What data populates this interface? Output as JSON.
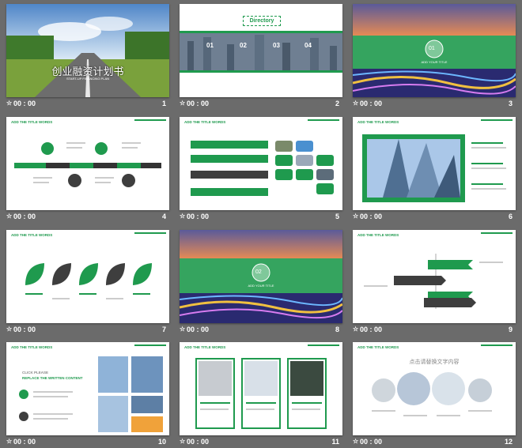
{
  "slides": [
    {
      "num": "1",
      "time": "00 : 00",
      "title": "创业融资计划书",
      "subtitle": "START-UP FINANCING PLAN"
    },
    {
      "num": "2",
      "time": "00 : 00",
      "directory": "Directory",
      "items": [
        "01",
        "02",
        "03",
        "04"
      ]
    },
    {
      "num": "3",
      "time": "00 : 00",
      "badge": "01",
      "caption": "ADD YOUR TITLE"
    },
    {
      "num": "4",
      "time": "00 : 00",
      "header": "ADD THE TITLE WORDS"
    },
    {
      "num": "5",
      "time": "00 : 00",
      "header": "ADD THE TITLE WORDS"
    },
    {
      "num": "6",
      "time": "00 : 00",
      "header": "ADD THE TITLE WORDS"
    },
    {
      "num": "7",
      "time": "00 : 00",
      "header": "ADD THE TITLE WORDS"
    },
    {
      "num": "8",
      "time": "00 : 00",
      "badge": "02",
      "caption": "ADD YOUR TITLE"
    },
    {
      "num": "9",
      "time": "00 : 00",
      "header": "ADD THE TITLE WORDS"
    },
    {
      "num": "10",
      "time": "00 : 00",
      "header": "ADD THE TITLE WORDS",
      "line1": "CLICK PLEASE",
      "line2": "REPLACE THE WRITTEN CONTENT"
    },
    {
      "num": "11",
      "time": "00 : 00",
      "header": "ADD THE TITLE WORDS"
    },
    {
      "num": "12",
      "time": "00 : 00",
      "header": "ADD THE TITLE WORDS",
      "center_title": "点击请替换文字内容"
    }
  ],
  "colors": {
    "accent": "#1f9a4e",
    "dark": "#3e3e3e",
    "background": "#6b6b6b"
  }
}
